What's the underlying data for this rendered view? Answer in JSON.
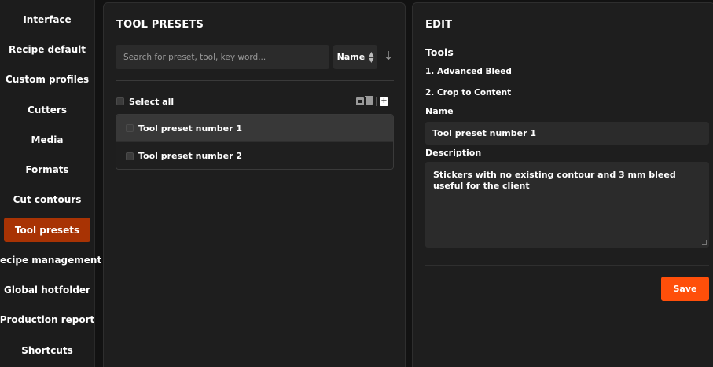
{
  "sidebar": {
    "items": [
      {
        "label": "Interface"
      },
      {
        "label": "Recipe default"
      },
      {
        "label": "Custom profiles"
      },
      {
        "label": "Cutters"
      },
      {
        "label": "Media"
      },
      {
        "label": "Formats"
      },
      {
        "label": "Cut contours"
      },
      {
        "label": "Tool presets"
      },
      {
        "label": "Recipe management"
      },
      {
        "label": "Global hotfolder"
      },
      {
        "label": "Production report"
      },
      {
        "label": "Shortcuts"
      }
    ],
    "active": "Tool presets"
  },
  "presets_panel": {
    "title": "TOOL PRESETS",
    "search": {
      "placeholder": "Search for preset, tool, key word...",
      "value": ""
    },
    "sort": {
      "label": "Name",
      "direction_icon": "arrow-down-icon"
    },
    "select_all_label": "Select all",
    "icons": [
      "archive-icon",
      "trash-icon",
      "add-icon"
    ],
    "items": [
      {
        "label": "Tool preset number 1",
        "selected": true
      },
      {
        "label": "Tool preset number 2",
        "selected": false
      }
    ]
  },
  "edit_panel": {
    "title": "EDIT",
    "tools_label": "Tools",
    "tools": [
      "1. Advanced Bleed",
      "2. Crop to Content"
    ],
    "name_label": "Name",
    "name_value": "Tool preset number 1",
    "description_label": "Description",
    "description_value": "Stickers with no existing contour and 3 mm bleed useful for the client",
    "save_label": "Save"
  },
  "colors": {
    "accent": "#ff4f0a",
    "active_nav": "#a83304",
    "background": "#121212",
    "panel": "#1e1e1e"
  }
}
